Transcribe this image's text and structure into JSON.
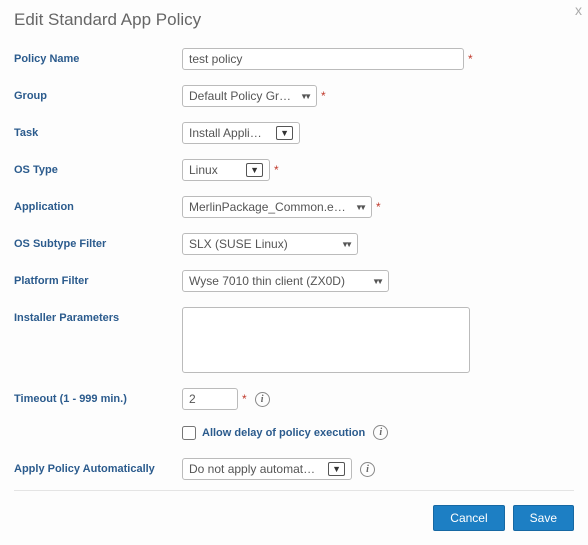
{
  "title": "Edit Standard App Policy",
  "labels": {
    "policyName": "Policy Name",
    "group": "Group",
    "task": "Task",
    "osType": "OS Type",
    "application": "Application",
    "osSubtype": "OS Subtype Filter",
    "platform": "Platform Filter",
    "installer": "Installer Parameters",
    "timeout": "Timeout (1 - 999 min.)",
    "applyAuto": "Apply Policy Automatically"
  },
  "values": {
    "policyName": "test policy",
    "group": "Default Policy Group",
    "task": "Install Application",
    "osType": "Linux",
    "application": "MerlinPackage_Common.exe (Loc",
    "osSubtype": "SLX (SUSE Linux)",
    "platform": "Wyse 7010 thin client (ZX0D)",
    "installer": "",
    "timeout": "2",
    "applyAuto": "Do not apply automatically"
  },
  "allowDelay": {
    "checked": false,
    "label": "Allow delay of policy execution"
  },
  "buttons": {
    "cancel": "Cancel",
    "save": "Save"
  }
}
